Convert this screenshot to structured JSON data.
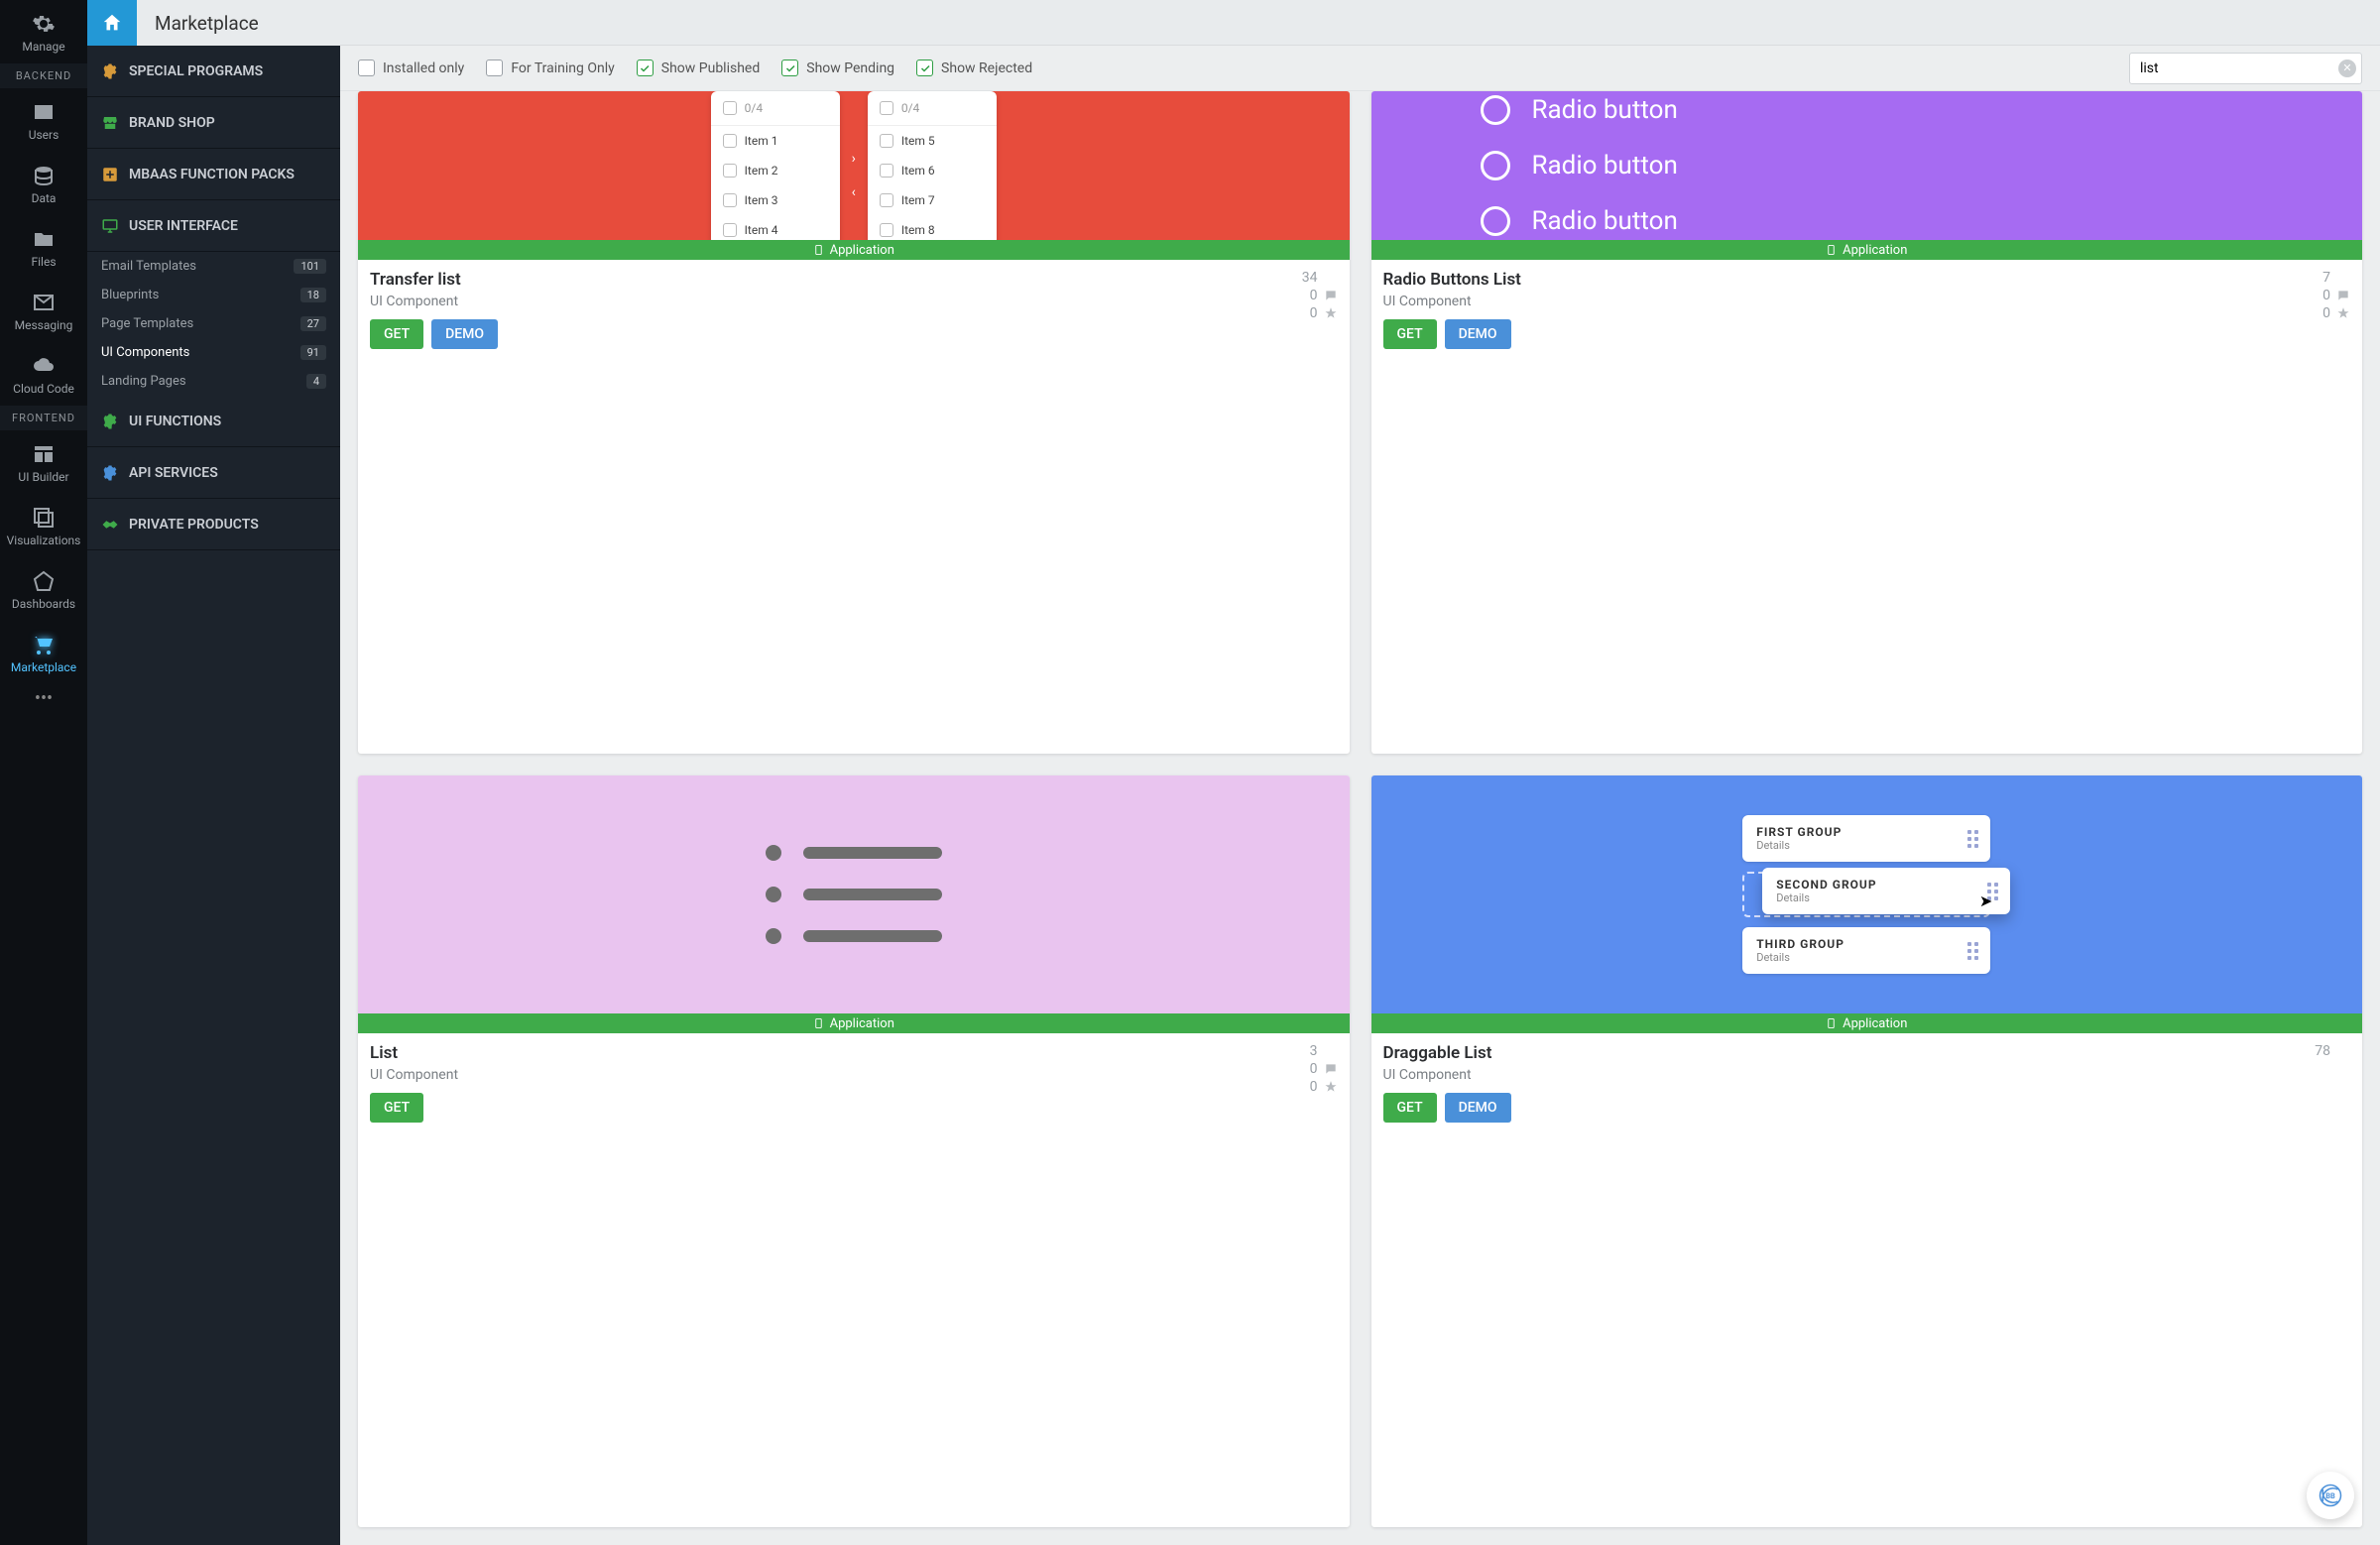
{
  "page_title": "Marketplace",
  "rail": {
    "groups": [
      {
        "header": "",
        "items": [
          {
            "id": "manage",
            "label": "Manage"
          }
        ]
      },
      {
        "header": "BACKEND",
        "items": [
          {
            "id": "users",
            "label": "Users"
          },
          {
            "id": "data",
            "label": "Data"
          },
          {
            "id": "files",
            "label": "Files"
          },
          {
            "id": "messaging",
            "label": "Messaging"
          },
          {
            "id": "cloudcode",
            "label": "Cloud Code"
          }
        ]
      },
      {
        "header": "FRONTEND",
        "items": [
          {
            "id": "uibuilder",
            "label": "UI Builder"
          },
          {
            "id": "visualizations",
            "label": "Visualizations"
          },
          {
            "id": "dashboards",
            "label": "Dashboards"
          },
          {
            "id": "marketplace",
            "label": "Marketplace",
            "active": true
          }
        ]
      }
    ]
  },
  "sidebar": {
    "categories": [
      {
        "id": "special",
        "label": "SPECIAL PROGRAMS",
        "icon": "gears",
        "color": "#d79a3a"
      },
      {
        "id": "brand",
        "label": "BRAND SHOP",
        "icon": "shop",
        "color": "#3fab4a"
      },
      {
        "id": "mbaas",
        "label": "MBAAS FUNCTION PACKS",
        "icon": "plus",
        "color": "#d79a3a"
      },
      {
        "id": "ui",
        "label": "USER INTERFACE",
        "icon": "monitor",
        "color": "#3fab4a",
        "expanded": true,
        "items": [
          {
            "id": "email",
            "label": "Email Templates",
            "count": "101"
          },
          {
            "id": "blue",
            "label": "Blueprints",
            "count": "18"
          },
          {
            "id": "pagetpl",
            "label": "Page Templates",
            "count": "27"
          },
          {
            "id": "uicomp",
            "label": "UI Components",
            "count": "91",
            "active": true
          },
          {
            "id": "landing",
            "label": "Landing Pages",
            "count": "4"
          }
        ]
      },
      {
        "id": "uifn",
        "label": "UI FUNCTIONS",
        "icon": "gears",
        "color": "#3fab4a"
      },
      {
        "id": "api",
        "label": "API SERVICES",
        "icon": "gears",
        "color": "#4a90d9"
      },
      {
        "id": "private",
        "label": "PRIVATE PRODUCTS",
        "icon": "handshake",
        "color": "#3fab4a"
      }
    ]
  },
  "filters": {
    "installed": {
      "label": "Installed only",
      "checked": false
    },
    "training": {
      "label": "For Training Only",
      "checked": false
    },
    "published": {
      "label": "Show Published",
      "checked": true
    },
    "pending": {
      "label": "Show Pending",
      "checked": true
    },
    "rejected": {
      "label": "Show Rejected",
      "checked": true
    },
    "search_value": "list"
  },
  "apptag_label": "Application",
  "buttons": {
    "get": "GET",
    "demo": "DEMO"
  },
  "cards": [
    {
      "id": "transfer",
      "title": "Transfer list",
      "subtitle": "UI Component",
      "downloads": "34",
      "comments": "0",
      "stars": "0",
      "has_demo": true,
      "thumb": {
        "left_header": "0/4",
        "right_header": "0/4",
        "left": [
          "Item 1",
          "Item 2",
          "Item 3",
          "Item 4"
        ],
        "right": [
          "Item 5",
          "Item 6",
          "Item 7",
          "Item 8"
        ]
      }
    },
    {
      "id": "radio",
      "title": "Radio Buttons List",
      "subtitle": "UI Component",
      "downloads": "7",
      "comments": "0",
      "stars": "0",
      "has_demo": true,
      "thumb": {
        "label": "Radio button"
      }
    },
    {
      "id": "list",
      "title": "List",
      "subtitle": "UI Component",
      "downloads": "3",
      "comments": "0",
      "stars": "0",
      "has_demo": false
    },
    {
      "id": "drag",
      "title": "Draggable List",
      "subtitle": "UI Component",
      "downloads": "78",
      "comments": "",
      "stars": "",
      "has_demo": true,
      "thumb": {
        "groups": [
          {
            "title": "FIRST GROUP",
            "detail": "Details"
          },
          {
            "title": "SECOND GROUP",
            "detail": "Details"
          },
          {
            "title": "THIRD GROUP",
            "detail": "Details"
          }
        ]
      }
    }
  ],
  "fab_label": "BB"
}
